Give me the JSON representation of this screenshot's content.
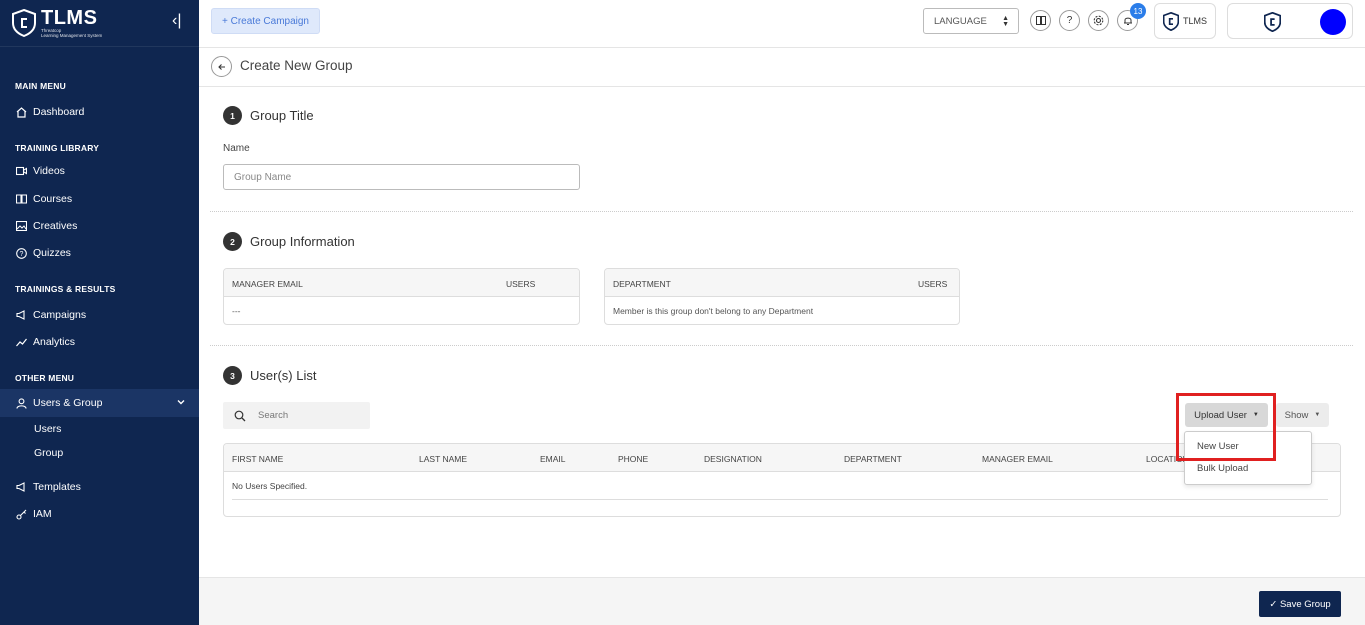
{
  "brand": {
    "title": "TLMS",
    "subtitle_line1": "Threatcop",
    "subtitle_line2": "Learning Management System",
    "collapse_glyph": "‹|"
  },
  "sidebar": {
    "sections": {
      "main_menu": "MAIN MENU",
      "training_library": "TRAINING LIBRARY",
      "trainings_results": "TRAININGS & RESULTS",
      "other_menu": "OTHER MENU"
    },
    "items": {
      "dashboard": "Dashboard",
      "videos": "Videos",
      "courses": "Courses",
      "creatives": "Creatives",
      "quizzes": "Quizzes",
      "campaigns": "Campaigns",
      "analytics": "Analytics",
      "users_group": "Users & Group",
      "users": "Users",
      "group": "Group",
      "templates": "Templates",
      "iam": "IAM"
    },
    "colors": {
      "background": "#0f2650",
      "active": "#1b3565"
    }
  },
  "topbar": {
    "create_campaign": "+ Create Campaign",
    "language": "LANGUAGE",
    "help_glyph": "?",
    "notifications_count": "13",
    "tlms_chip": "TLMS"
  },
  "page": {
    "title": "Create New Group",
    "steps": [
      {
        "num": "1",
        "title": "Group Title"
      },
      {
        "num": "2",
        "title": "Group Information"
      },
      {
        "num": "3",
        "title": "User(s) List"
      }
    ],
    "name_label": "Name",
    "name_placeholder": "Group Name",
    "manager_card": {
      "col1": "MANAGER EMAIL",
      "col2": "USERS",
      "value": "---"
    },
    "department_card": {
      "col1": "DEPARTMENT",
      "col2": "USERS",
      "value": "Member is this group don't belong to any Department"
    },
    "search_placeholder": "Search",
    "upload_user": "Upload User",
    "show": "Show",
    "dropdown": [
      "New User",
      "Bulk Upload"
    ],
    "table": {
      "columns": [
        "FIRST NAME",
        "LAST NAME",
        "EMAIL",
        "PHONE",
        "DESIGNATION",
        "DEPARTMENT",
        "MANAGER EMAIL",
        "LOCATION"
      ],
      "empty": "No Users Specified."
    },
    "save_group": "✓ Save Group"
  }
}
